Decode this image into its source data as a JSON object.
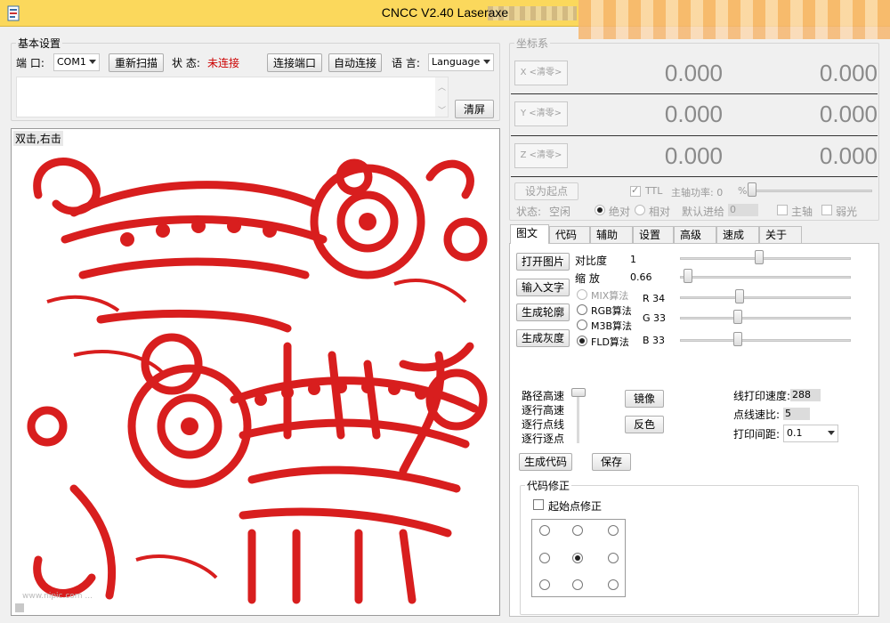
{
  "window": {
    "title": "CNCC V2.40  Laseraxe"
  },
  "basic": {
    "group_title": "基本设置",
    "port_label": "端  口:",
    "port_value": "COM1",
    "rescan_label": "重新扫描",
    "status_label": "状  态:",
    "status_value": "未连接",
    "status_color": "#cc0000",
    "connect_label": "连接端口",
    "auto_connect_label": "自动连接",
    "language_label": "语  言:",
    "language_value": "Language",
    "clear_label": "清屏"
  },
  "image_area": {
    "hint": "双击,右击",
    "image_color": "#d81e1e",
    "watermark": "www.nipic.com  ...  "
  },
  "coords": {
    "group_title": "坐标系",
    "rows": [
      {
        "axis": "X <清零>",
        "value1": "0.000",
        "value2": "0.000"
      },
      {
        "axis": "Y <清零>",
        "value1": "0.000",
        "value2": "0.000"
      },
      {
        "axis": "Z <清零>",
        "value1": "0.000",
        "value2": "0.000"
      }
    ],
    "set_origin_label": "设为起点",
    "ttl_label": "TTL",
    "spindle_power_label": "主轴功率: 0",
    "percent": "%",
    "state_label": "状态:",
    "state_value": "空闲",
    "absolute_label": "绝对",
    "relative_label": "相对",
    "default_feed_label": "默认进给",
    "default_feed_value": "0",
    "spindle_label": "主轴",
    "weak_light_label": "弱光"
  },
  "tabs": [
    "图文",
    "代码",
    "辅助",
    "设置",
    "高级",
    "速成",
    "关于"
  ],
  "image_tab": {
    "open_image": "打开图片",
    "input_text": "输入文字",
    "gen_outline": "生成轮廓",
    "gen_gray": "生成灰度",
    "contrast_label": "对比度",
    "contrast_value": "1",
    "contrast_fraction": 0.46,
    "scale_label": "缩  放",
    "scale_value": "0.66",
    "scale_fraction": 0.02,
    "algos": [
      "MIX算法",
      "RGB算法",
      "M3B算法",
      "FLD算法"
    ],
    "r_label": "R  34",
    "g_label": "G  33",
    "b_label": "B  33",
    "r_fraction": 0.34,
    "g_fraction": 0.33,
    "b_fraction": 0.33,
    "path_modes": [
      "路径高速",
      "逐行高速",
      "逐行点线",
      "逐行逐点"
    ],
    "mirror": "镜像",
    "invert": "反色",
    "line_speed_label": "线打印速度:",
    "line_speed_value": "288",
    "dot_ratio_label": "点线速比:",
    "dot_ratio_value": "5",
    "print_spacing_label": "打印间距:",
    "print_spacing_value": "0.1",
    "gen_code": "生成代码",
    "save": "保存",
    "code_fix_title": "代码修正",
    "start_fix_label": "起始点修正"
  }
}
